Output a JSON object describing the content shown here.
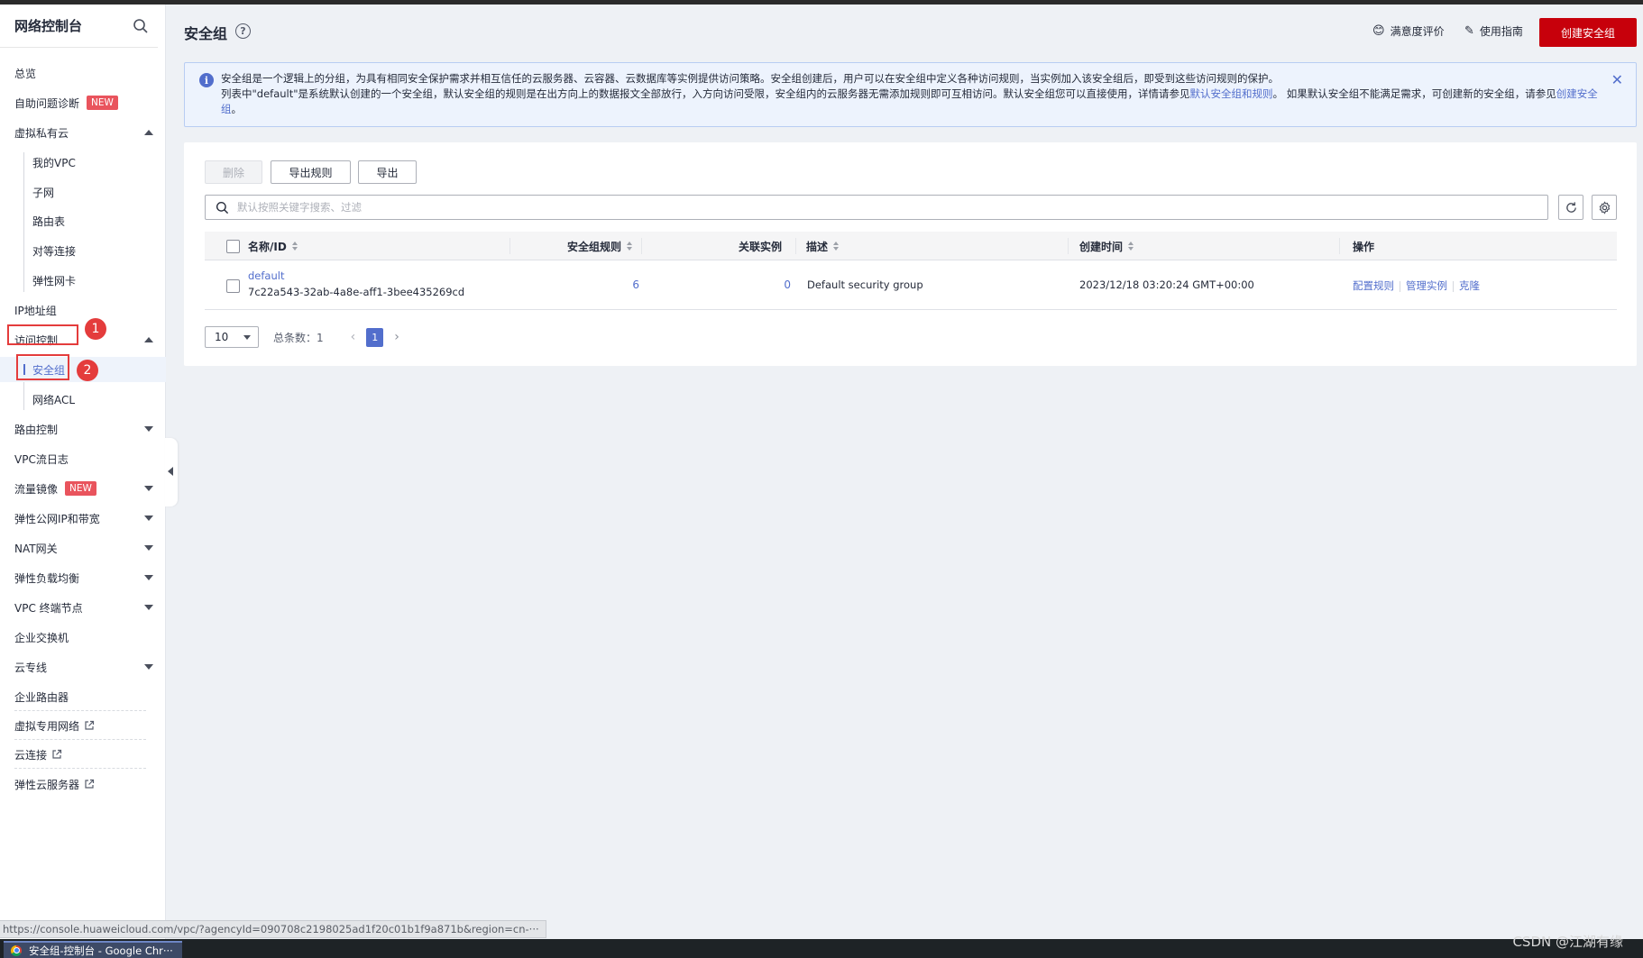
{
  "sidebar": {
    "title": "网络控制台",
    "items": [
      {
        "label": "总览"
      },
      {
        "label": "自助问题诊断",
        "badge": "NEW"
      },
      {
        "label": "虚拟私有云"
      },
      {
        "label": "我的VPC"
      },
      {
        "label": "子网"
      },
      {
        "label": "路由表"
      },
      {
        "label": "对等连接"
      },
      {
        "label": "弹性网卡"
      },
      {
        "label": "IP地址组"
      },
      {
        "label": "访问控制"
      },
      {
        "label": "安全组"
      },
      {
        "label": "网络ACL"
      },
      {
        "label": "路由控制"
      },
      {
        "label": "VPC流日志"
      },
      {
        "label": "流量镜像",
        "badge": "NEW"
      },
      {
        "label": "弹性公网IP和带宽"
      },
      {
        "label": "NAT网关"
      },
      {
        "label": "弹性负载均衡"
      },
      {
        "label": "VPC 终端节点"
      },
      {
        "label": "企业交换机"
      },
      {
        "label": "云专线"
      },
      {
        "label": "企业路由器"
      },
      {
        "label": "虚拟专用网络"
      },
      {
        "label": "云连接"
      },
      {
        "label": "弹性云服务器"
      }
    ]
  },
  "annotations": {
    "one": "1",
    "two": "2"
  },
  "header": {
    "title": "安全组",
    "satisfaction": "满意度评价",
    "guide": "使用指南",
    "create_button": "创建安全组"
  },
  "notice": {
    "line1": "安全组是一个逻辑上的分组，为具有相同安全保护需求并相互信任的云服务器、云容器、云数据库等实例提供访问策略。安全组创建后，用户可以在安全组中定义各种访问规则，当实例加入该安全组后，即受到这些访问规则的保护。",
    "line2_a": "列表中\"default\"是系统默认创建的一个安全组，默认安全组的规则是在出方向上的数据报文全部放行，入方向访问受限，安全组内的云服务器无需添加规则即可互相访问。默认安全组您可以直接使用，详情请参见",
    "link1": "默认安全组和规则",
    "line2_b": "。 如果默认安全组不能满足需求，可创建新的安全组，请参见",
    "link2": "创建安全组",
    "line2_c": "。"
  },
  "toolbar": {
    "delete_label": "删除",
    "export_rules_label": "导出规则",
    "export_label": "导出",
    "search_placeholder": "默认按照关键字搜索、过滤"
  },
  "table": {
    "columns": {
      "name": "名称/ID",
      "rules": "安全组规则",
      "instances": "关联实例",
      "desc": "描述",
      "created": "创建时间",
      "ops": "操作"
    },
    "rows": [
      {
        "name": "default",
        "id": "7c22a543-32ab-4a8e-aff1-3bee435269cd",
        "rules": "6",
        "instances": "0",
        "desc": "Default security group",
        "created": "2023/12/18 03:20:24 GMT+00:00",
        "op1": "配置规则",
        "op2": "管理实例",
        "op3": "克隆"
      }
    ]
  },
  "pagination": {
    "page_size": "10",
    "total": "总条数：1",
    "current_page": "1"
  },
  "status_url": "https://console.huaweicloud.com/vpc/?agencyId=090708c2198025ad1f20c01b1f9a871b&region=cn-···",
  "taskbar": {
    "app": "安全组-控制台 - Google Chr···"
  },
  "watermark": "CSDN @江湖有缘",
  "colors": {
    "accent": "#526ecc",
    "brand_red": "#c7000b",
    "badge_red": "#e9545d",
    "annotation_red": "#e43c3c"
  }
}
